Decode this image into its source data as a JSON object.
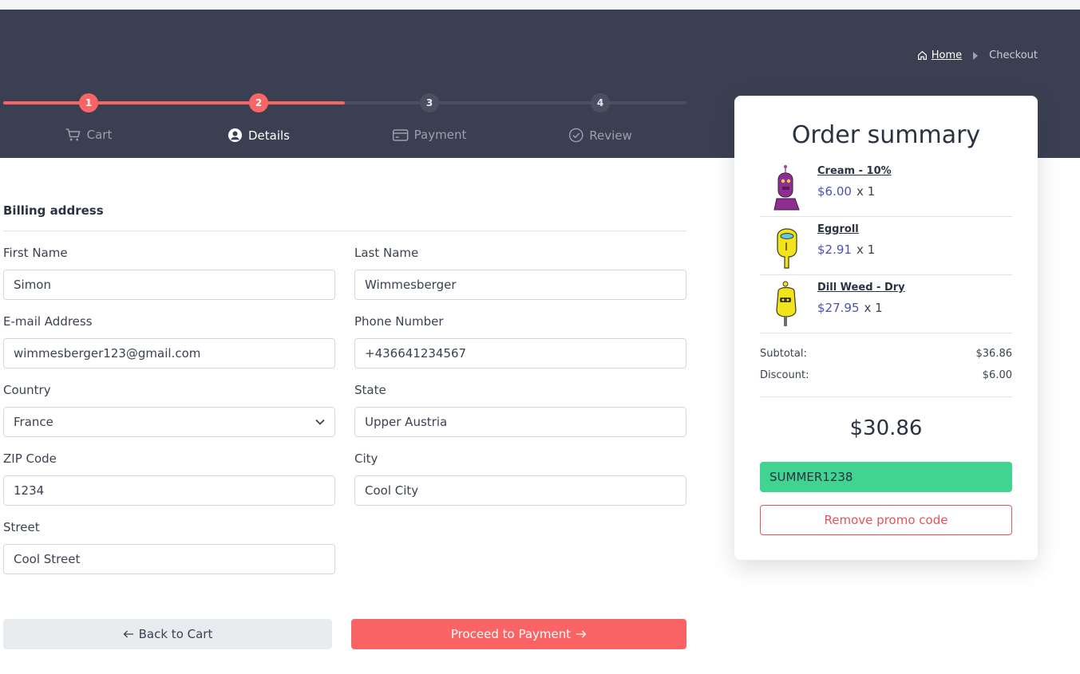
{
  "breadcrumb": {
    "home": "Home",
    "current": "Checkout"
  },
  "steps": [
    {
      "number": "1",
      "label": "Cart"
    },
    {
      "number": "2",
      "label": "Details"
    },
    {
      "number": "3",
      "label": "Payment"
    },
    {
      "number": "4",
      "label": "Review"
    }
  ],
  "current_step": 2,
  "billing": {
    "title": "Billing address",
    "first_name": {
      "label": "First Name",
      "value": "Simon"
    },
    "last_name": {
      "label": "Last Name",
      "value": "Wimmesberger"
    },
    "email": {
      "label": "E-mail Address",
      "value": "wimmesberger123@gmail.com"
    },
    "phone": {
      "label": "Phone Number",
      "value": "+436641234567"
    },
    "country": {
      "label": "Country",
      "value": "France"
    },
    "state": {
      "label": "State",
      "value": "Upper Austria"
    },
    "zip": {
      "label": "ZIP Code",
      "value": "1234"
    },
    "city": {
      "label": "City",
      "value": "Cool City"
    },
    "street": {
      "label": "Street",
      "value": "Cool Street"
    }
  },
  "actions": {
    "back": "Back to Cart",
    "next": "Proceed to Payment"
  },
  "summary": {
    "title": "Order summary",
    "items": [
      {
        "name": "Cream - 10%",
        "price": "$6.00",
        "qty": "x 1"
      },
      {
        "name": "Eggroll",
        "price": "$2.91",
        "qty": "x 1"
      },
      {
        "name": "Dill Weed - Dry",
        "price": "$27.95",
        "qty": "x 1"
      }
    ],
    "subtotal_label": "Subtotal:",
    "subtotal": "$36.86",
    "discount_label": "Discount:",
    "discount": "$6.00",
    "total": "$30.86",
    "promo_code": "SUMMER1238",
    "remove_label": "Remove promo code"
  },
  "colors": {
    "header": "#3a4051",
    "accent": "#fa6464",
    "promo": "#40d391",
    "price": "#4b50b8"
  }
}
